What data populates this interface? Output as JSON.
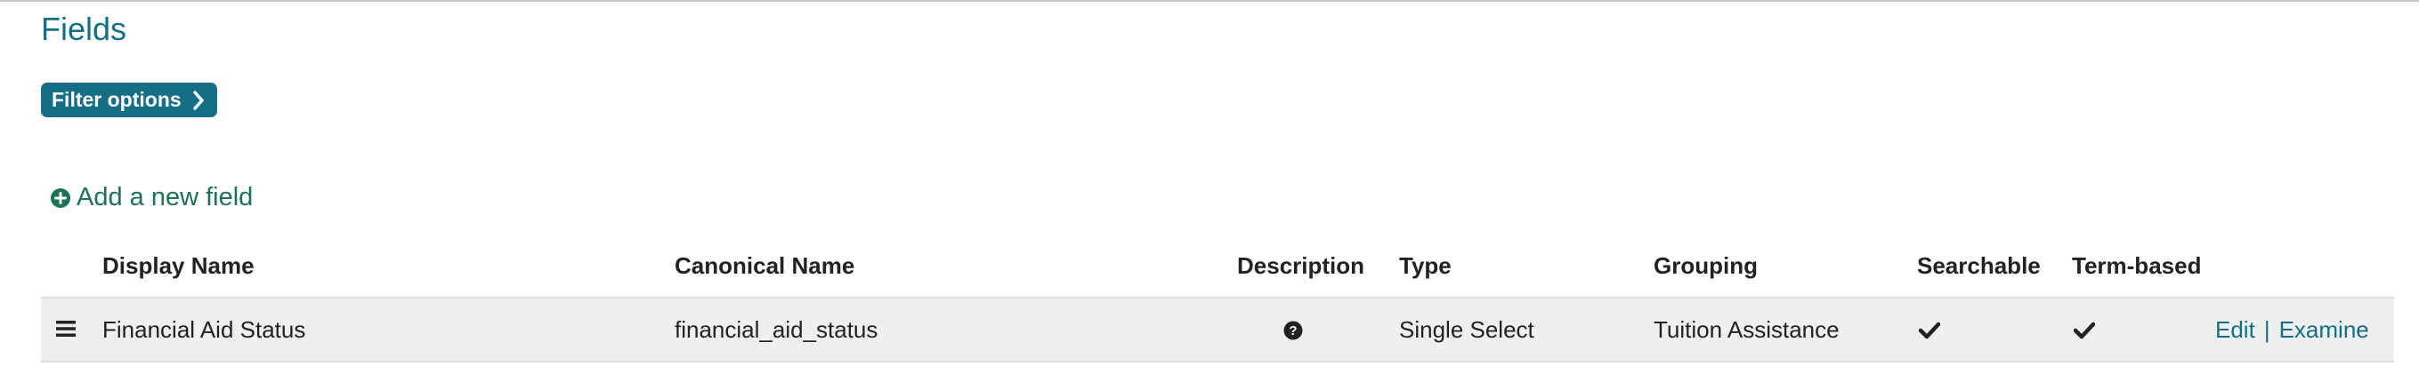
{
  "page": {
    "title": "Fields"
  },
  "filter": {
    "label": "Filter options",
    "icon": "chevron-right-icon"
  },
  "add_field": {
    "label": "Add a new field",
    "icon": "plus-circle-icon"
  },
  "table": {
    "columns": [
      "Display Name",
      "Canonical Name",
      "Description",
      "Type",
      "Grouping",
      "Searchable",
      "Term-based"
    ],
    "rows": [
      {
        "display_name": "Financial Aid Status",
        "canonical_name": "financial_aid_status",
        "description_icon": "question-circle-icon",
        "type": "Single Select",
        "grouping": "Tuition Assistance",
        "searchable": true,
        "term_based": true,
        "actions": [
          "Edit",
          "Examine"
        ],
        "separator": "|"
      }
    ]
  },
  "colors": {
    "accent": "#146f86",
    "add_link": "#1a7355",
    "row_background": "#efefef"
  }
}
